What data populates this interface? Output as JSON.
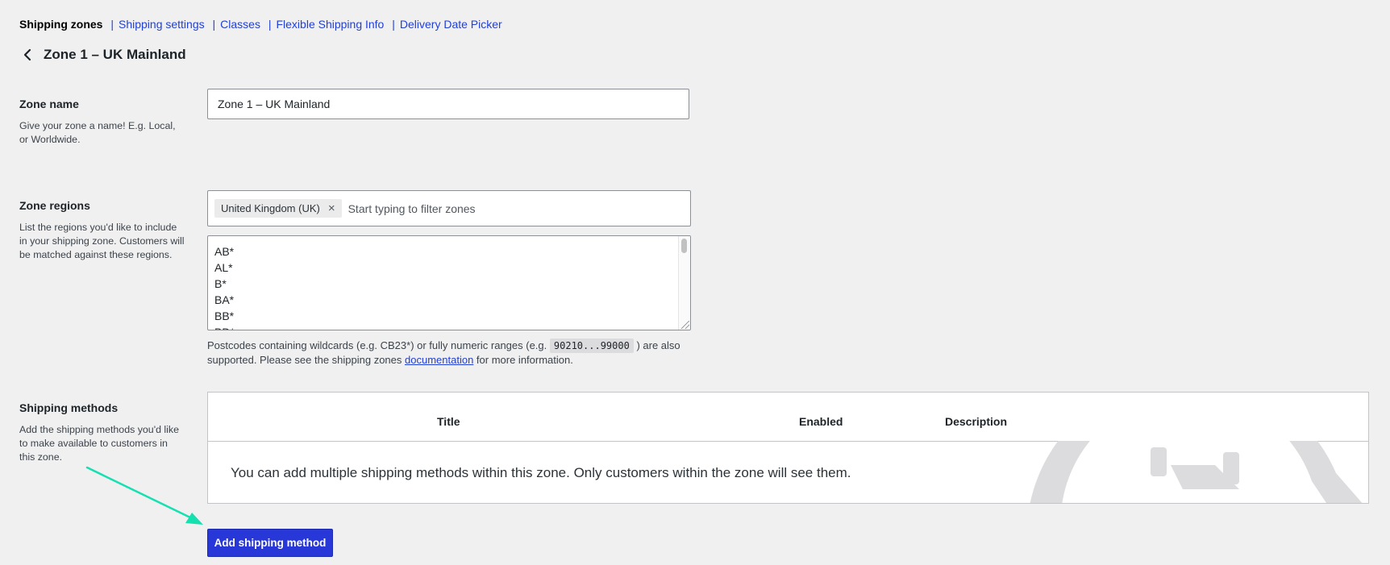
{
  "subnav": {
    "current": "Shipping zones",
    "links": [
      "Shipping settings",
      "Classes",
      "Flexible Shipping Info",
      "Delivery Date Picker"
    ],
    "separator": "|"
  },
  "header": {
    "title": "Zone 1 – UK Mainland"
  },
  "zone_name": {
    "label": "Zone name",
    "description": "Give your zone a name! E.g. Local, or Worldwide.",
    "value": "Zone 1 – UK Mainland"
  },
  "zone_regions": {
    "label": "Zone regions",
    "description": "List the regions you'd like to include in your shipping zone. Customers will be matched against these regions.",
    "selected_chip": "United Kingdom (UK)",
    "chip_remove": "×",
    "placeholder": "Start typing to filter zones",
    "postcodes": [
      "AB*",
      "AL*",
      "B*",
      "BA*",
      "BB*",
      "BD*"
    ],
    "hint_prefix": "Postcodes containing wildcards (e.g. CB23*) or fully numeric ranges (e.g.",
    "hint_code": "90210...99000",
    "hint_middle": ") are also supported. Please see the shipping zones",
    "hint_link": "documentation",
    "hint_suffix": "for more information."
  },
  "shipping_methods": {
    "label": "Shipping methods",
    "description": "Add the shipping methods you'd like to make available to customers in this zone.",
    "columns": [
      "Title",
      "Enabled",
      "Description"
    ],
    "empty_message": "You can add multiple shipping methods within this zone. Only customers within the zone will see them.",
    "add_button": "Add shipping method"
  },
  "colors": {
    "link": "#2240d6",
    "primary_button": "#2837d8",
    "annotation_arrow": "#14e0b0",
    "background": "#f0f0f1"
  }
}
